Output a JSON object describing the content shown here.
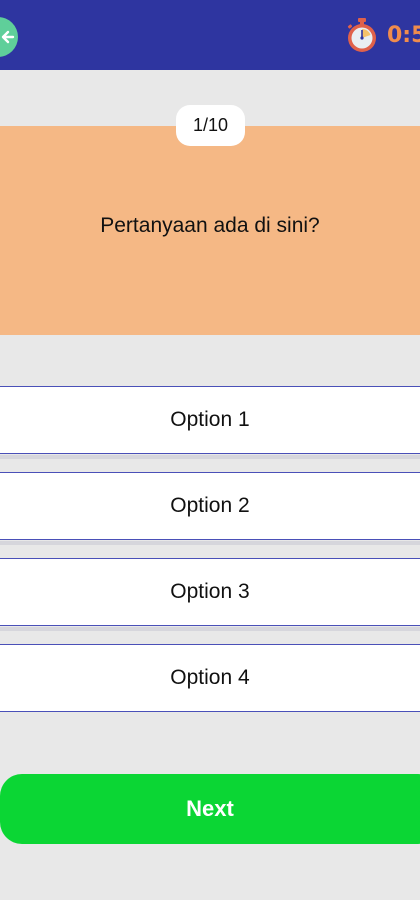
{
  "header": {
    "back_icon": "arrow-left-icon",
    "timer_icon": "stopwatch-icon",
    "timer_text": "0:5",
    "colors": {
      "bar": "#2e35a0",
      "back": "#5fcf9a",
      "timer": "#f08c4d"
    }
  },
  "question": {
    "counter": "1/10",
    "text": "Pertanyaan ada di sini?",
    "card_color": "#f5b885"
  },
  "options": [
    {
      "label": "Option 1"
    },
    {
      "label": "Option 2"
    },
    {
      "label": "Option 3"
    },
    {
      "label": "Option 4"
    }
  ],
  "footer": {
    "next_label": "Next",
    "next_color": "#0bd634"
  }
}
